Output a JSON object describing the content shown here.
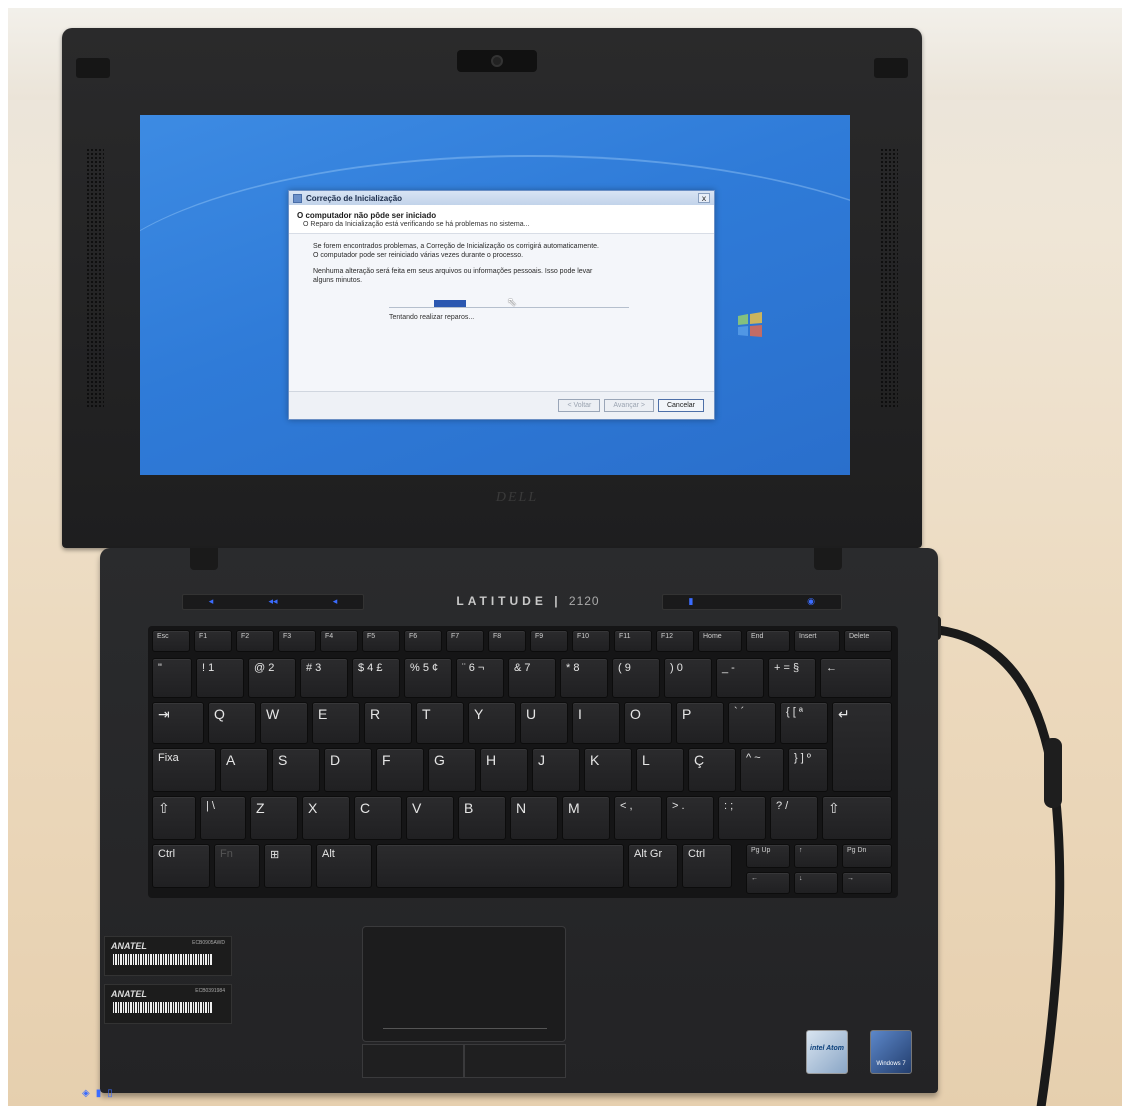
{
  "dialog": {
    "title": "Correção de Inicialização",
    "close_glyph": "x",
    "heading": "O computador não pôde ser iniciado",
    "subheading": "O Reparo da Inicialização está verificando se há problemas no sistema...",
    "paragraph1_line1": "Se forem encontrados problemas, a Correção de Inicialização os corrigirá automaticamente.",
    "paragraph1_line2": "O computador pode ser reiniciado várias vezes durante o processo.",
    "paragraph2_line1": "Nenhuma alteração será feita em seus arquivos ou informações pessoais. Isso pode levar",
    "paragraph2_line2": "alguns minutos.",
    "progress_status": "Tentando realizar reparos...",
    "buttons": {
      "back": "< Voltar",
      "next": "Avançar >",
      "cancel": "Cancelar"
    }
  },
  "laptop": {
    "brand": "LATITUDE",
    "model": "2120",
    "lid_logo": "DELL"
  },
  "keyboard": {
    "fn_row": [
      "Esc",
      "F1",
      "F2",
      "F3",
      "F4",
      "F5",
      "F6",
      "F7",
      "F8",
      "F9",
      "F10",
      "F11",
      "F12",
      "Home",
      "End",
      "Insert",
      "Delete"
    ],
    "number_row": [
      "\"",
      "! 1",
      "@ 2",
      "# 3",
      "$ 4 £",
      "% 5 ¢",
      "¨ 6 ¬",
      "& 7",
      "* 8",
      "( 9",
      ") 0",
      "_ -",
      "+ = §",
      "←"
    ],
    "top_row": [
      "⇥",
      "Q",
      "W",
      "E",
      "R",
      "T",
      "Y",
      "U",
      "I",
      "O",
      "P",
      "` ´",
      "{ [ ª",
      "↵"
    ],
    "home_row": [
      "Fixa",
      "A",
      "S",
      "D",
      "F",
      "G",
      "H",
      "J",
      "K",
      "L",
      "Ç",
      "^ ~",
      "} ] º"
    ],
    "bottom_row": [
      "⇧",
      "| \\",
      "Z",
      "X",
      "C",
      "V",
      "B",
      "N",
      "M",
      "< ,",
      "> .",
      ": ;",
      "? /",
      "⇧"
    ],
    "space_row": [
      "Ctrl",
      "Fn",
      "⊞",
      "Alt",
      "",
      "Alt Gr",
      "Ctrl",
      "Pg Up",
      "↑",
      "Pg Dn"
    ],
    "arrow_row": [
      "←",
      "↓",
      "→"
    ]
  },
  "stickers": [
    {
      "brand": "ANATEL",
      "code": "ECB0905AWD"
    },
    {
      "brand": "ANATEL",
      "code": "ECB0391984"
    }
  ],
  "badges": {
    "intel": "intel Atom",
    "windows": "Windows 7"
  },
  "colors": {
    "wallpaper": "#2f7bd8",
    "indicator_led": "#3b6cff",
    "dialog_progress": "#2b57b0"
  }
}
